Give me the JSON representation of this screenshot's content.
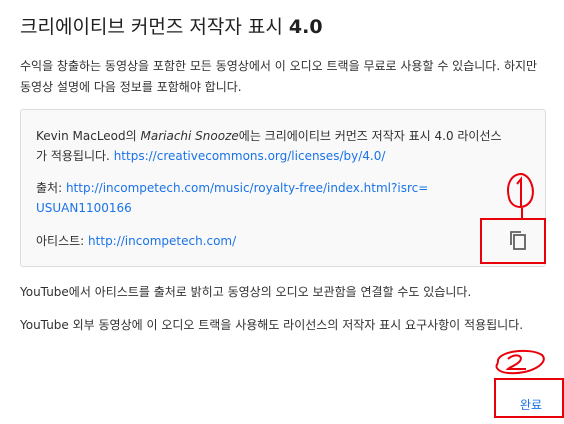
{
  "dialog": {
    "title_prefix": "크리에이티브 커먼즈 저작자 표시",
    "title_version": "4.0",
    "intro": "수익을 창출하는 동영상을 포함한 모든 동영상에서 이 오디오 트랙을 무료로 사용할 수 있습니다. 하지만 동영상 설명에 다음 정보를 포함해야 합니다."
  },
  "attribution": {
    "artist_name": "Kevin MacLeod의",
    "track_title": "Mariachi Snooze",
    "license_text": "에는 크리에이티브 커먼즈 저작자 표시 4.0 라이선스가 적용됩니다.",
    "license_url": "https://creativecommons.org/licenses/by/4.0/",
    "source_label": "출처:",
    "source_url": "http://incompetech.com/music/royalty-free/index.html?isrc=USUAN1100166",
    "artist_label": "아티스트:",
    "artist_url": "http://incompetech.com/"
  },
  "footer": {
    "line1": "YouTube에서 아티스트를 출처로 밝히고 동영상의 오디오 보관함을 연결할 수도 있습니다.",
    "line2": "YouTube 외부 동영상에 이 오디오 트랙을 사용해도 라이선스의 저작자 표시 요구사항이 적용됩니다."
  },
  "actions": {
    "done_label": "완료"
  },
  "icons": {
    "copy": "copy-icon"
  },
  "colors": {
    "link": "#1a73e8",
    "annotation": "#e8000b"
  }
}
